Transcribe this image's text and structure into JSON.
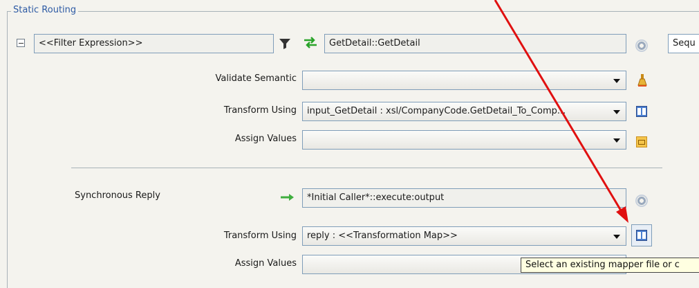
{
  "section": {
    "title": "Static Routing"
  },
  "filter": {
    "value": "<<Filter Expression>>"
  },
  "operation": {
    "value": "GetDetail::GetDetail",
    "sequence_value": "Sequ"
  },
  "validate": {
    "label": "Validate Semantic",
    "value": ""
  },
  "transform_request": {
    "label": "Transform Using",
    "value": "input_GetDetail : xsl/CompanyCode.GetDetail_To_Comp..."
  },
  "assign_request": {
    "label": "Assign Values",
    "value": ""
  },
  "reply": {
    "label": "Synchronous Reply",
    "target": "*Initial Caller*::execute:output"
  },
  "transform_reply": {
    "label": "Transform Using",
    "value": "reply : <<Transformation Map>>"
  },
  "assign_reply": {
    "label": "Assign Values",
    "value": ""
  },
  "tooltip": {
    "text": "Select an existing mapper file or c"
  },
  "colors": {
    "annotation_arrow": "#e01010",
    "title": "#2d5aa4"
  }
}
